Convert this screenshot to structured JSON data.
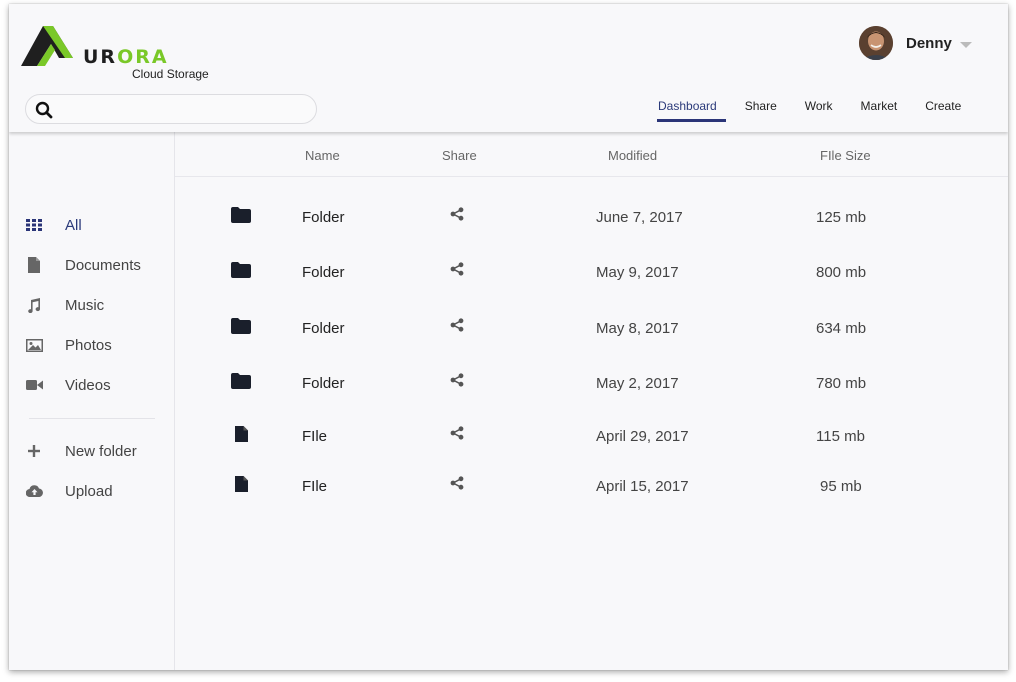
{
  "brand": {
    "logo_first_letter": "A",
    "logo_dark": "UR",
    "logo_green": "ORA",
    "subtitle": "Cloud Storage",
    "accent_color": "#7ac828",
    "primary_color": "#2b3578"
  },
  "user": {
    "name": "Denny"
  },
  "search": {
    "placeholder": "",
    "value": ""
  },
  "nav": {
    "tabs": [
      {
        "label": "Dashboard",
        "active": true
      },
      {
        "label": "Share"
      },
      {
        "label": "Work"
      },
      {
        "label": "Market"
      },
      {
        "label": "Create"
      }
    ]
  },
  "sidebar": {
    "items": [
      {
        "label": "All",
        "icon": "grid-icon",
        "active": true
      },
      {
        "label": "Documents",
        "icon": "document-icon"
      },
      {
        "label": "Music",
        "icon": "music-note-icon"
      },
      {
        "label": "Photos",
        "icon": "image-icon"
      },
      {
        "label": "Videos",
        "icon": "video-camera-icon"
      }
    ],
    "actions": [
      {
        "label": "New folder",
        "icon": "plus-icon"
      },
      {
        "label": "Upload",
        "icon": "cloud-upload-icon"
      }
    ]
  },
  "table": {
    "columns": [
      "Name",
      "Share",
      "Modified",
      "FIle Size"
    ],
    "rows": [
      {
        "type": "folder-icon",
        "name": "Folder",
        "modified": "June 7, 2017",
        "size": "125 mb"
      },
      {
        "type": "folder-icon",
        "name": "Folder",
        "modified": "May 9, 2017",
        "size": "800 mb"
      },
      {
        "type": "folder-icon",
        "name": "Folder",
        "modified": "May 8, 2017",
        "size": "634 mb"
      },
      {
        "type": "folder-icon",
        "name": "Folder",
        "modified": "May 2, 2017",
        "size": "780 mb"
      },
      {
        "type": "file-icon",
        "name": "FIle",
        "modified": "April 29, 2017",
        "size": "115 mb"
      },
      {
        "type": "file-icon",
        "name": "FIle",
        "modified": "April 15, 2017",
        "size": "95 mb"
      }
    ]
  }
}
